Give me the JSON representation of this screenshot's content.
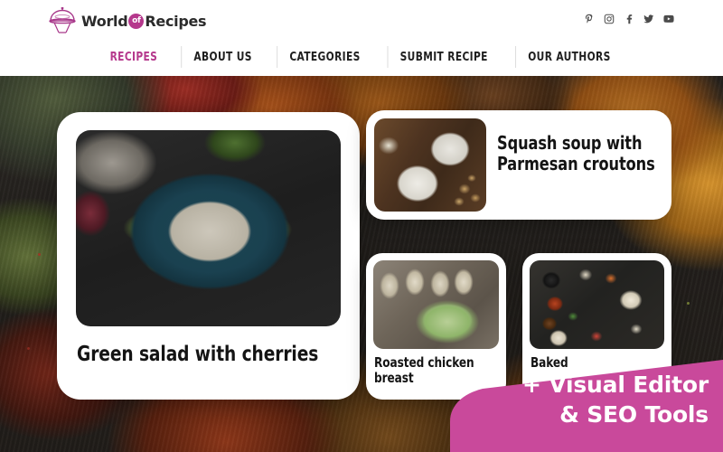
{
  "header": {
    "logo": {
      "word1": "World",
      "badge": "of",
      "word2": "Recipes",
      "icon": "cloche-dome-icon"
    },
    "social": [
      {
        "name": "pinterest-icon",
        "label": "Pinterest"
      },
      {
        "name": "instagram-icon",
        "label": "Instagram"
      },
      {
        "name": "facebook-icon",
        "label": "Facebook"
      },
      {
        "name": "twitter-icon",
        "label": "Twitter"
      },
      {
        "name": "youtube-icon",
        "label": "YouTube"
      }
    ],
    "nav": [
      {
        "label": "RECIPES",
        "active": true
      },
      {
        "label": "ABOUT US",
        "active": false
      },
      {
        "label": "CATEGORIES",
        "active": false
      },
      {
        "label": "SUBMIT RECIPE",
        "active": false
      },
      {
        "label": "OUR AUTHORS",
        "active": false
      }
    ]
  },
  "cards": [
    {
      "title": "Green salad with cherries",
      "image": "salad-in-teal-bowl-photo"
    },
    {
      "title": "Squash soup with Parmesan croutons",
      "image": "green-soup-bowls-photo"
    },
    {
      "title": "Roasted chicken breast",
      "image": "khinkali-and-salad-photo"
    },
    {
      "title": "Baked",
      "image": "asian-food-spread-photo"
    }
  ],
  "ribbon": {
    "line1": "+ Visual Editor",
    "line2": "& SEO Tools"
  },
  "colors": {
    "accent_pink": "#c9499b",
    "nav_active": "#b5388c",
    "nav_text": "#1f1f1f",
    "card_bg": "#ffffff",
    "header_bg": "#ffffff",
    "title_text": "#141414",
    "ribbon_text": "#ffffff"
  }
}
